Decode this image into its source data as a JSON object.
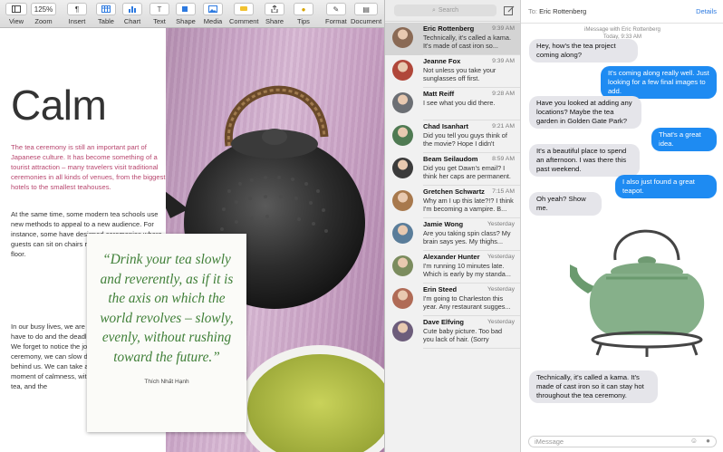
{
  "toolbar": {
    "items": [
      {
        "label": "View"
      },
      {
        "label": "Zoom",
        "value": "125%"
      },
      {
        "label": "Insert"
      },
      {
        "label": "Table"
      },
      {
        "label": "Chart"
      },
      {
        "label": "Text"
      },
      {
        "label": "Shape"
      },
      {
        "label": "Media"
      },
      {
        "label": "Comment"
      },
      {
        "label": "Share"
      },
      {
        "label": "Tips"
      },
      {
        "label": "Format"
      },
      {
        "label": "Document"
      }
    ]
  },
  "document": {
    "title": "Calm",
    "lead": "The tea ceremony is still an important part of Japanese culture. It has become something of a tourist attraction – many travelers visit traditional ceremonies in all kinds of venues, from the biggest hotels to the smallest teahouses.",
    "body1": "At the same time, some modern tea schools use new methods to appeal to a new audience. For instance, some have designed ceremonies where guests can sit on chairs rather than kneeling on the floor.",
    "body2": "In our busy lives, we are often focused on the jobs we have to do and the deadlines that are looming over us. We forget to notice the joys in our lives. Through the tea ceremony, we can slow down and leave our worries behind us. We can take a moment of meditation: a moment of calmness, with nothing but our friends, our tea, and the",
    "quote": "“Drink your tea slowly and reverently, as if it is the axis on which the world revolves – slowly, evenly, without rushing toward the future.”",
    "quote_author": "Thích Nhất Hạnh"
  },
  "sidebar": {
    "search_placeholder": "Search",
    "conversations": [
      {
        "name": "Eric Rottenberg",
        "time": "9:39 AM",
        "preview": "Technically, it's called a kama. It's made of cast iron so...",
        "avatar_color": "#8a6a55",
        "selected": true
      },
      {
        "name": "Jeanne Fox",
        "time": "9:39 AM",
        "preview": "Not unless you take your sunglasses off first.",
        "avatar_color": "#b0473a"
      },
      {
        "name": "Matt Reiff",
        "time": "9:28 AM",
        "preview": "I see what you did there.",
        "avatar_color": "#6c6f74"
      },
      {
        "name": "Chad Isanhart",
        "time": "9:21 AM",
        "preview": "Did you tell you guys think of the movie? Hope I didn't over...",
        "avatar_color": "#4f7a52"
      },
      {
        "name": "Beam Seilaudom",
        "time": "8:59 AM",
        "preview": "Did you get Dawn's email? I think her caps are permanent.",
        "avatar_color": "#3b3b3b"
      },
      {
        "name": "Gretchen Schwartz",
        "time": "7:15 AM",
        "preview": "Why am I up this late?!? I think I'm becoming a vampire. B...",
        "avatar_color": "#a8794d"
      },
      {
        "name": "Jamie Wong",
        "time": "Yesterday",
        "preview": "Are you taking spin class? My brain says yes. My thighs...",
        "avatar_color": "#5a7d9a"
      },
      {
        "name": "Alexander Hunter",
        "time": "Yesterday",
        "preview": "I'm running 10 minutes late. Which is early by my standa...",
        "avatar_color": "#7b8c5e"
      },
      {
        "name": "Erin Steed",
        "time": "Yesterday",
        "preview": "I'm going to Charleston this year. Any restaurant sugges...",
        "avatar_color": "#b06b56"
      },
      {
        "name": "Dave Elfving",
        "time": "Yesterday",
        "preview": "Cute baby picture. Too bad you lack of hair. (Sorry",
        "avatar_color": "#6d5d7b"
      }
    ]
  },
  "chat": {
    "to_label": "To:",
    "recipient": "Eric Rottenberg",
    "details_label": "Details",
    "meta_line1": "iMessage with Eric Rottenberg",
    "meta_line2": "Today, 9:33 AM",
    "messages": [
      {
        "dir": "in",
        "text": "Hey, how's the tea project coming along?"
      },
      {
        "dir": "out",
        "text": "It's coming along really well. Just looking for a few final images to add."
      },
      {
        "dir": "in",
        "text": "Have you looked at adding any locations? Maybe the tea garden in Golden Gate Park?"
      },
      {
        "dir": "out",
        "text": "That's a great idea."
      },
      {
        "dir": "in",
        "text": "It's a beautiful place to spend an afternoon. I was there this past weekend."
      },
      {
        "dir": "out",
        "text": "I also just found a great teapot."
      },
      {
        "dir": "in",
        "text": "Oh yeah? Show me."
      },
      {
        "dir": "in",
        "text": "Technically, it's called a kama. It's made of cast iron so it can stay hot throughout the tea ceremony."
      }
    ],
    "composer_placeholder": "iMessage",
    "colors": {
      "outgoing": "#1e8bf2",
      "incoming": "#e5e5ea",
      "link": "#2d7ae0"
    }
  }
}
